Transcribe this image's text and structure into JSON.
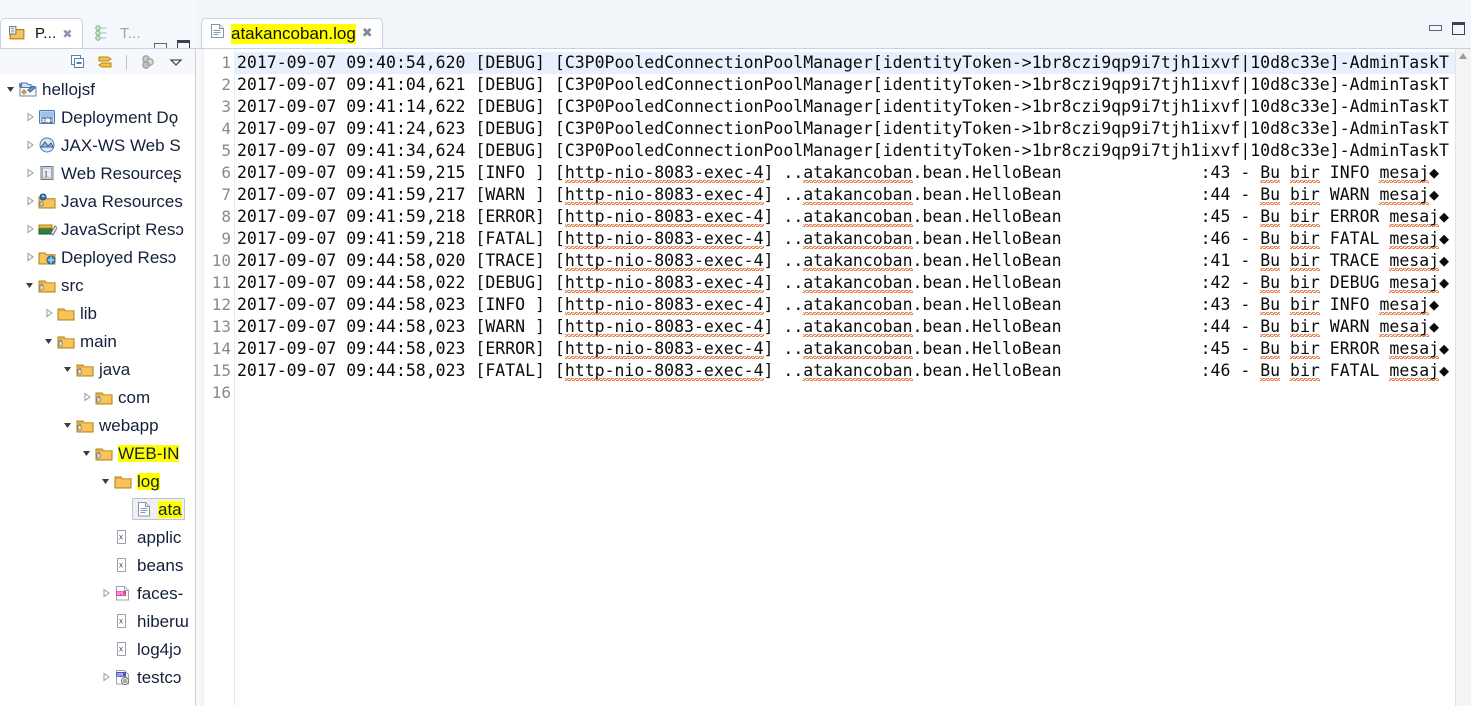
{
  "window": {
    "minimize_label": "minimize",
    "maximize_label": "maximize"
  },
  "left_view": {
    "tabs": [
      {
        "label": "P...",
        "icon": "project-explorer-icon",
        "active": true,
        "close": "✖"
      },
      {
        "label": "T...",
        "icon": "task-list-icon",
        "active": false
      }
    ],
    "toolbar": [
      {
        "name": "collapse-all-icon",
        "label": "Collapse All"
      },
      {
        "name": "link-with-editor-icon",
        "label": "Link with Editor"
      },
      {
        "name": "separator",
        "label": ""
      },
      {
        "name": "filter-icon",
        "label": "Filters"
      },
      {
        "name": "view-menu-icon",
        "label": "View Menu"
      }
    ],
    "tree": [
      {
        "depth": 0,
        "twisty": "expanded",
        "icon": "project-icon",
        "label": "hellojsf",
        "highlight": false
      },
      {
        "depth": 1,
        "twisty": "collapsed",
        "icon": "deployment-descriptor-icon",
        "label": "Deployment Dǫ",
        "highlight": false
      },
      {
        "depth": 1,
        "twisty": "collapsed",
        "icon": "jaxws-icon",
        "label": "JAX-WS Web S",
        "highlight": false
      },
      {
        "depth": 1,
        "twisty": "collapsed",
        "icon": "web-resources-icon",
        "label": "Web Resourceʂ",
        "highlight": false
      },
      {
        "depth": 1,
        "twisty": "collapsed",
        "icon": "java-resources-icon",
        "label": "Java Resources",
        "highlight": false
      },
      {
        "depth": 1,
        "twisty": "collapsed",
        "icon": "javascript-resources-icon",
        "label": "JavaScript Resɔ",
        "highlight": false
      },
      {
        "depth": 1,
        "twisty": "collapsed",
        "icon": "deployed-resources-icon",
        "label": "Deployed Resɔ",
        "highlight": false
      },
      {
        "depth": 1,
        "twisty": "expanded",
        "icon": "source-folder-icon",
        "label": "src",
        "highlight": false
      },
      {
        "depth": 2,
        "twisty": "collapsed",
        "icon": "folder-icon",
        "label": "lib",
        "highlight": false
      },
      {
        "depth": 2,
        "twisty": "expanded",
        "icon": "source-folder-icon",
        "label": "main",
        "highlight": false
      },
      {
        "depth": 3,
        "twisty": "expanded",
        "icon": "source-folder-icon",
        "label": "java",
        "highlight": false
      },
      {
        "depth": 4,
        "twisty": "collapsed",
        "icon": "source-folder-icon",
        "label": "com",
        "highlight": false
      },
      {
        "depth": 3,
        "twisty": "expanded",
        "icon": "source-folder-icon",
        "label": "webapp",
        "highlight": false
      },
      {
        "depth": 4,
        "twisty": "expanded",
        "icon": "source-folder-icon",
        "label": "WEB-IN",
        "highlight": true
      },
      {
        "depth": 5,
        "twisty": "expanded",
        "icon": "folder-icon",
        "label": "log",
        "highlight": true
      },
      {
        "depth": 6,
        "twisty": "none",
        "icon": "file-icon",
        "label": "ata",
        "highlight": true,
        "selected": true
      },
      {
        "depth": 5,
        "twisty": "none",
        "icon": "xml-file-icon",
        "label": "applic",
        "highlight": false
      },
      {
        "depth": 5,
        "twisty": "none",
        "icon": "xml-file-icon",
        "label": "beans",
        "highlight": false
      },
      {
        "depth": 5,
        "twisty": "collapsed",
        "icon": "xml-doc-icon",
        "label": "faces-",
        "highlight": false
      },
      {
        "depth": 5,
        "twisty": "none",
        "icon": "xml-file-icon",
        "label": "hiberɯ",
        "highlight": false
      },
      {
        "depth": 5,
        "twisty": "none",
        "icon": "xml-file-icon",
        "label": "log4jɔ",
        "highlight": false
      },
      {
        "depth": 5,
        "twisty": "collapsed",
        "icon": "xml-config-icon",
        "label": "testcɔ",
        "highlight": false
      }
    ]
  },
  "editor": {
    "tab": {
      "icon": "log-file-icon",
      "title": "atakancoban.log",
      "close": "✖",
      "highlighted": true
    },
    "gutter": {
      "line_numbers": [
        "1",
        "2",
        "3",
        "4",
        "5",
        "6",
        "7",
        "8",
        "9",
        "10",
        "11",
        "12",
        "13",
        "14",
        "15",
        "16"
      ]
    },
    "current_line": 1,
    "lines": [
      "2017-09-07 09:40:54,620 [DEBUG] [C3P0PooledConnectionPoolManager[identityToken->1br8czi9qp9i7tjh1ixvf|10d8c33e]-AdminTaskT",
      "2017-09-07 09:41:04,621 [DEBUG] [C3P0PooledConnectionPoolManager[identityToken->1br8czi9qp9i7tjh1ixvf|10d8c33e]-AdminTaskT",
      "2017-09-07 09:41:14,622 [DEBUG] [C3P0PooledConnectionPoolManager[identityToken->1br8czi9qp9i7tjh1ixvf|10d8c33e]-AdminTaskT",
      "2017-09-07 09:41:24,623 [DEBUG] [C3P0PooledConnectionPoolManager[identityToken->1br8czi9qp9i7tjh1ixvf|10d8c33e]-AdminTaskT",
      "2017-09-07 09:41:34,624 [DEBUG] [C3P0PooledConnectionPoolManager[identityToken->1br8czi9qp9i7tjh1ixvf|10d8c33e]-AdminTaskT",
      "2017-09-07 09:41:59,215 [INFO ] [http-nio-8083-exec-4] ..atakancoban.bean.HelloBean              :43 - Bu bir INFO mesaj◆",
      "2017-09-07 09:41:59,217 [WARN ] [http-nio-8083-exec-4] ..atakancoban.bean.HelloBean              :44 - Bu bir WARN mesaj◆",
      "2017-09-07 09:41:59,218 [ERROR] [http-nio-8083-exec-4] ..atakancoban.bean.HelloBean              :45 - Bu bir ERROR mesaj◆",
      "2017-09-07 09:41:59,218 [FATAL] [http-nio-8083-exec-4] ..atakancoban.bean.HelloBean              :46 - Bu bir FATAL mesaj◆",
      "2017-09-07 09:44:58,020 [TRACE] [http-nio-8083-exec-4] ..atakancoban.bean.HelloBean              :41 - Bu bir TRACE mesaj◆",
      "2017-09-07 09:44:58,022 [DEBUG] [http-nio-8083-exec-4] ..atakancoban.bean.HelloBean              :42 - Bu bir DEBUG mesaj◆",
      "2017-09-07 09:44:58,023 [INFO ] [http-nio-8083-exec-4] ..atakancoban.bean.HelloBean              :43 - Bu bir INFO mesaj◆",
      "2017-09-07 09:44:58,023 [WARN ] [http-nio-8083-exec-4] ..atakancoban.bean.HelloBean              :44 - Bu bir WARN mesaj◆",
      "2017-09-07 09:44:58,023 [ERROR] [http-nio-8083-exec-4] ..atakancoban.bean.HelloBean              :45 - Bu bir ERROR mesaj◆",
      "2017-09-07 09:44:58,023 [FATAL] [http-nio-8083-exec-4] ..atakancoban.bean.HelloBean              :46 - Bu bir FATAL mesaj◆",
      ""
    ]
  },
  "colors": {
    "highlight": "#ffff00",
    "current_line": "#e8f0fd",
    "spellcheck_underline": "#e06020",
    "tab_border": "#c6d3e2",
    "chrome": "#f2f5fa"
  }
}
